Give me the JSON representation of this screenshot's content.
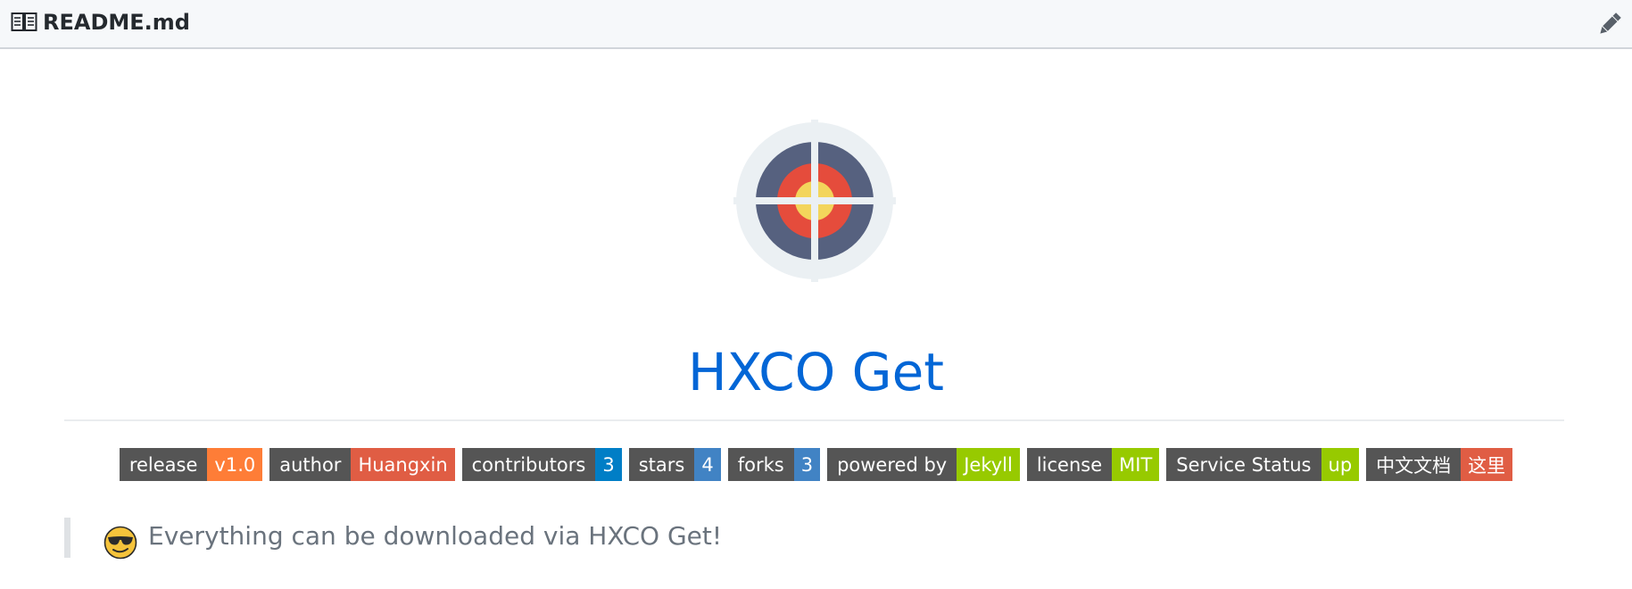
{
  "header": {
    "file_name": "README.md",
    "edit_icon": "pencil-icon",
    "file_icon": "book-icon"
  },
  "logo": {
    "icon": "target-icon"
  },
  "title": "HXCO Get",
  "badges": [
    {
      "label": "release",
      "value": "v1.0",
      "color": "#fe7d37"
    },
    {
      "label": "author",
      "value": "Huangxin",
      "color": "#e05d44"
    },
    {
      "label": "contributors",
      "value": "3",
      "color": "#007ec6"
    },
    {
      "label": "stars",
      "value": "4",
      "color": "#4183c4"
    },
    {
      "label": "forks",
      "value": "3",
      "color": "#4183c4"
    },
    {
      "label": "powered by",
      "value": "Jekyll",
      "color": "#97ca00"
    },
    {
      "label": "license",
      "value": "MIT",
      "color": "#97ca00"
    },
    {
      "label": "Service Status",
      "value": "up",
      "color": "#97ca00"
    },
    {
      "label": "中文文档",
      "value": "这里",
      "color": "#e05d44"
    }
  ],
  "quote": {
    "emoji": "sunglasses-emoji-icon",
    "text": "Everything can be downloaded via HXCO Get!"
  }
}
